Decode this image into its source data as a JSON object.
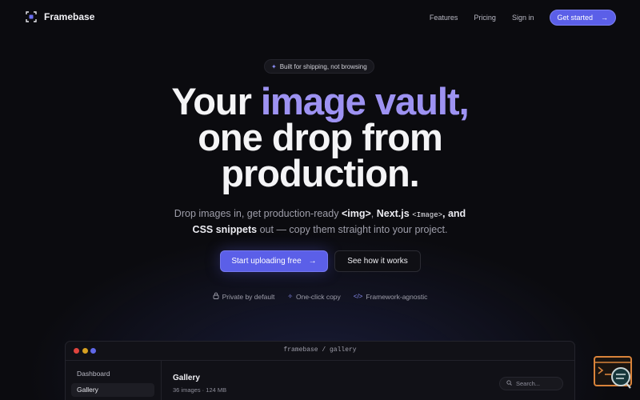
{
  "nav": {
    "brand": "Framebase",
    "links": [
      "Features",
      "Pricing",
      "Sign in"
    ],
    "cta": "Get started"
  },
  "hero": {
    "badge": "Built for shipping, not browsing",
    "headline": {
      "line1_plain": "Your ",
      "line1_accent": "image vault,",
      "line2": "one drop from",
      "line3": "production."
    },
    "sub": {
      "p1": "Drop images in, get production-ready ",
      "code_img": "<img>",
      "p2": ", ",
      "nextjs": "Next.js",
      "code_image": "<Image>",
      "p3": ", and",
      "css": "CSS snippets",
      "p4": " out — copy them straight into your project."
    },
    "primary_button": "Start uploading free",
    "secondary_button": "See how it works",
    "features": [
      "Private by default",
      "One-click copy",
      "Framework-agnostic"
    ]
  },
  "app": {
    "path": "framebase / gallery",
    "sidebar": [
      "Dashboard",
      "Gallery"
    ],
    "title": "Gallery",
    "meta": "36 images · 124 MB",
    "search_placeholder": "Search..."
  },
  "colors": {
    "accent": "#5b5fe8",
    "accent_text": "#9d92f2",
    "background": "#0b0b0f"
  },
  "icons": {
    "logo": "frame-logo-icon",
    "arrow": "arrow-right-icon",
    "lock": "lock-icon",
    "copy": "sparkle-icon",
    "code": "code-icon",
    "search": "search-icon",
    "widget": "terminal-help-icon"
  }
}
